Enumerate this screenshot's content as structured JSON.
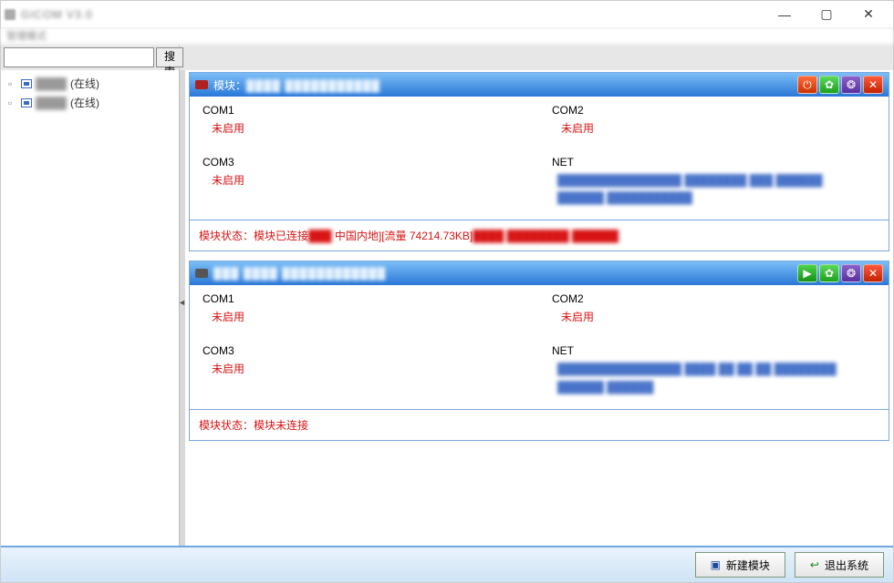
{
  "window": {
    "title": "GICOM V3.0",
    "subtitle": "管理模式"
  },
  "search": {
    "button": "搜索序号"
  },
  "sidebar": {
    "items": [
      {
        "status": "(在线)"
      },
      {
        "status": "(在线)"
      }
    ]
  },
  "modules": [
    {
      "title_prefix": "模块：",
      "ports": {
        "com1": {
          "label": "COM1",
          "value": "未启用"
        },
        "com2": {
          "label": "COM2",
          "value": "未启用"
        },
        "com3": {
          "label": "COM3",
          "value": "未启用"
        },
        "net": {
          "label": "NET"
        }
      },
      "status_prefix": "模块状态：模块已连接",
      "status_mid": " 中国内地][流量 74214.73KB]"
    },
    {
      "ports": {
        "com1": {
          "label": "COM1",
          "value": "未启用"
        },
        "com2": {
          "label": "COM2",
          "value": "未启用"
        },
        "com3": {
          "label": "COM3",
          "value": "未启用"
        },
        "net": {
          "label": "NET"
        }
      },
      "status": "模块状态：模块未连接"
    }
  ],
  "footer": {
    "new_module": "新建模块",
    "exit": "退出系统"
  }
}
